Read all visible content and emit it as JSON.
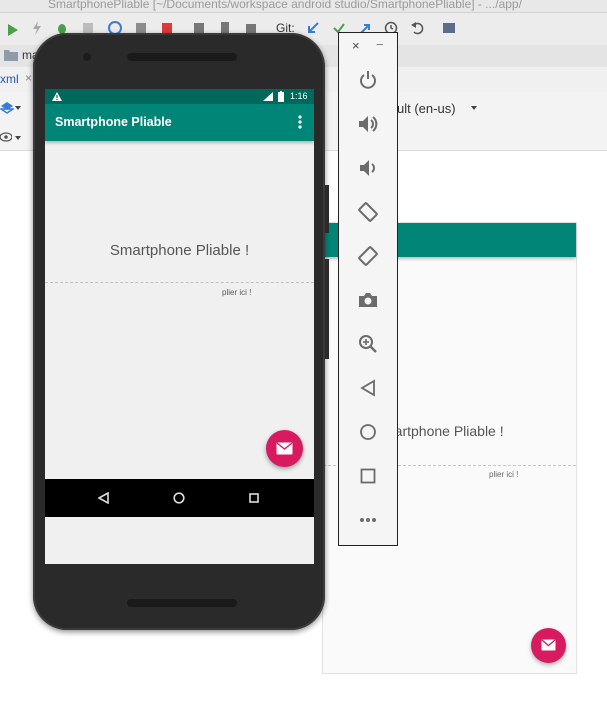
{
  "ide": {
    "window_title": "SmartphonePliable [~/Documents/workspace android studio/SmartphonePliable] - .../app/",
    "git_label": "Git:",
    "project_tab": "ma",
    "file_tab": "xml",
    "locale": "ult (en-us)"
  },
  "preview": {
    "label": "martphone Pliable !",
    "hint": "plier ici !"
  },
  "phone": {
    "status_time": "1:16",
    "app_title": "Smartphone Pliable",
    "center_text": "Smartphone Pliable !",
    "hint_text": "plier ici !"
  },
  "emulator_toolbar": {
    "close": "×",
    "minimize": "−",
    "items": [
      "power-icon",
      "volume-up-icon",
      "volume-down-icon",
      "rotate-left-icon",
      "rotate-right-icon",
      "camera-icon",
      "zoom-icon",
      "back-icon",
      "home-icon",
      "overview-icon",
      "more-icon"
    ]
  },
  "colors": {
    "primary": "#008577",
    "primary_dark": "#00695c",
    "accent": "#d81b60"
  }
}
